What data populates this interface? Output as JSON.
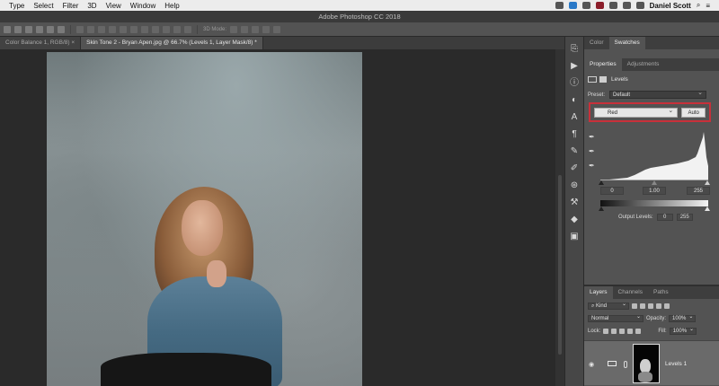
{
  "menubar": {
    "items": [
      "Type",
      "Select",
      "Filter",
      "3D",
      "View",
      "Window",
      "Help"
    ],
    "user": "Daniel Scott"
  },
  "titlebar": {
    "title": "Adobe Photoshop CC 2018"
  },
  "optionsbar": {
    "mode_label": "3D Mode:"
  },
  "doc_tabs": [
    {
      "label": "Color Balance 1, RGB/8) ×",
      "active": false
    },
    {
      "label": "Skin Tone 2 - Bryan Apen.jpg @ 66.7% (Levels 1, Layer Mask/8) *",
      "active": true
    }
  ],
  "top_panel": {
    "tabs": [
      "Color",
      "Swatches"
    ],
    "active": "Swatches"
  },
  "properties": {
    "tabs": [
      "Properties",
      "Adjustments"
    ],
    "active_tab": "Properties",
    "adjustment_name": "Levels",
    "preset_label": "Preset:",
    "preset_value": "Default",
    "channel_value": "Red",
    "auto_label": "Auto",
    "input_black": "0",
    "input_gamma": "1.00",
    "input_white": "255",
    "output_label": "Output Levels:",
    "output_black": "0",
    "output_white": "255"
  },
  "layers": {
    "tabs": [
      "Layers",
      "Channels",
      "Paths"
    ],
    "active_tab": "Layers",
    "filter_label": "Kind",
    "blend_mode": "Normal",
    "opacity_label": "Opacity:",
    "opacity_value": "100%",
    "lock_label": "Lock:",
    "fill_label": "Fill:",
    "fill_value": "100%",
    "layer_name": "Levels 1"
  },
  "colors": {
    "highlight_box": "#c8303a",
    "panel_bg": "#535353",
    "canvas_bg": "#2a2a2a"
  }
}
